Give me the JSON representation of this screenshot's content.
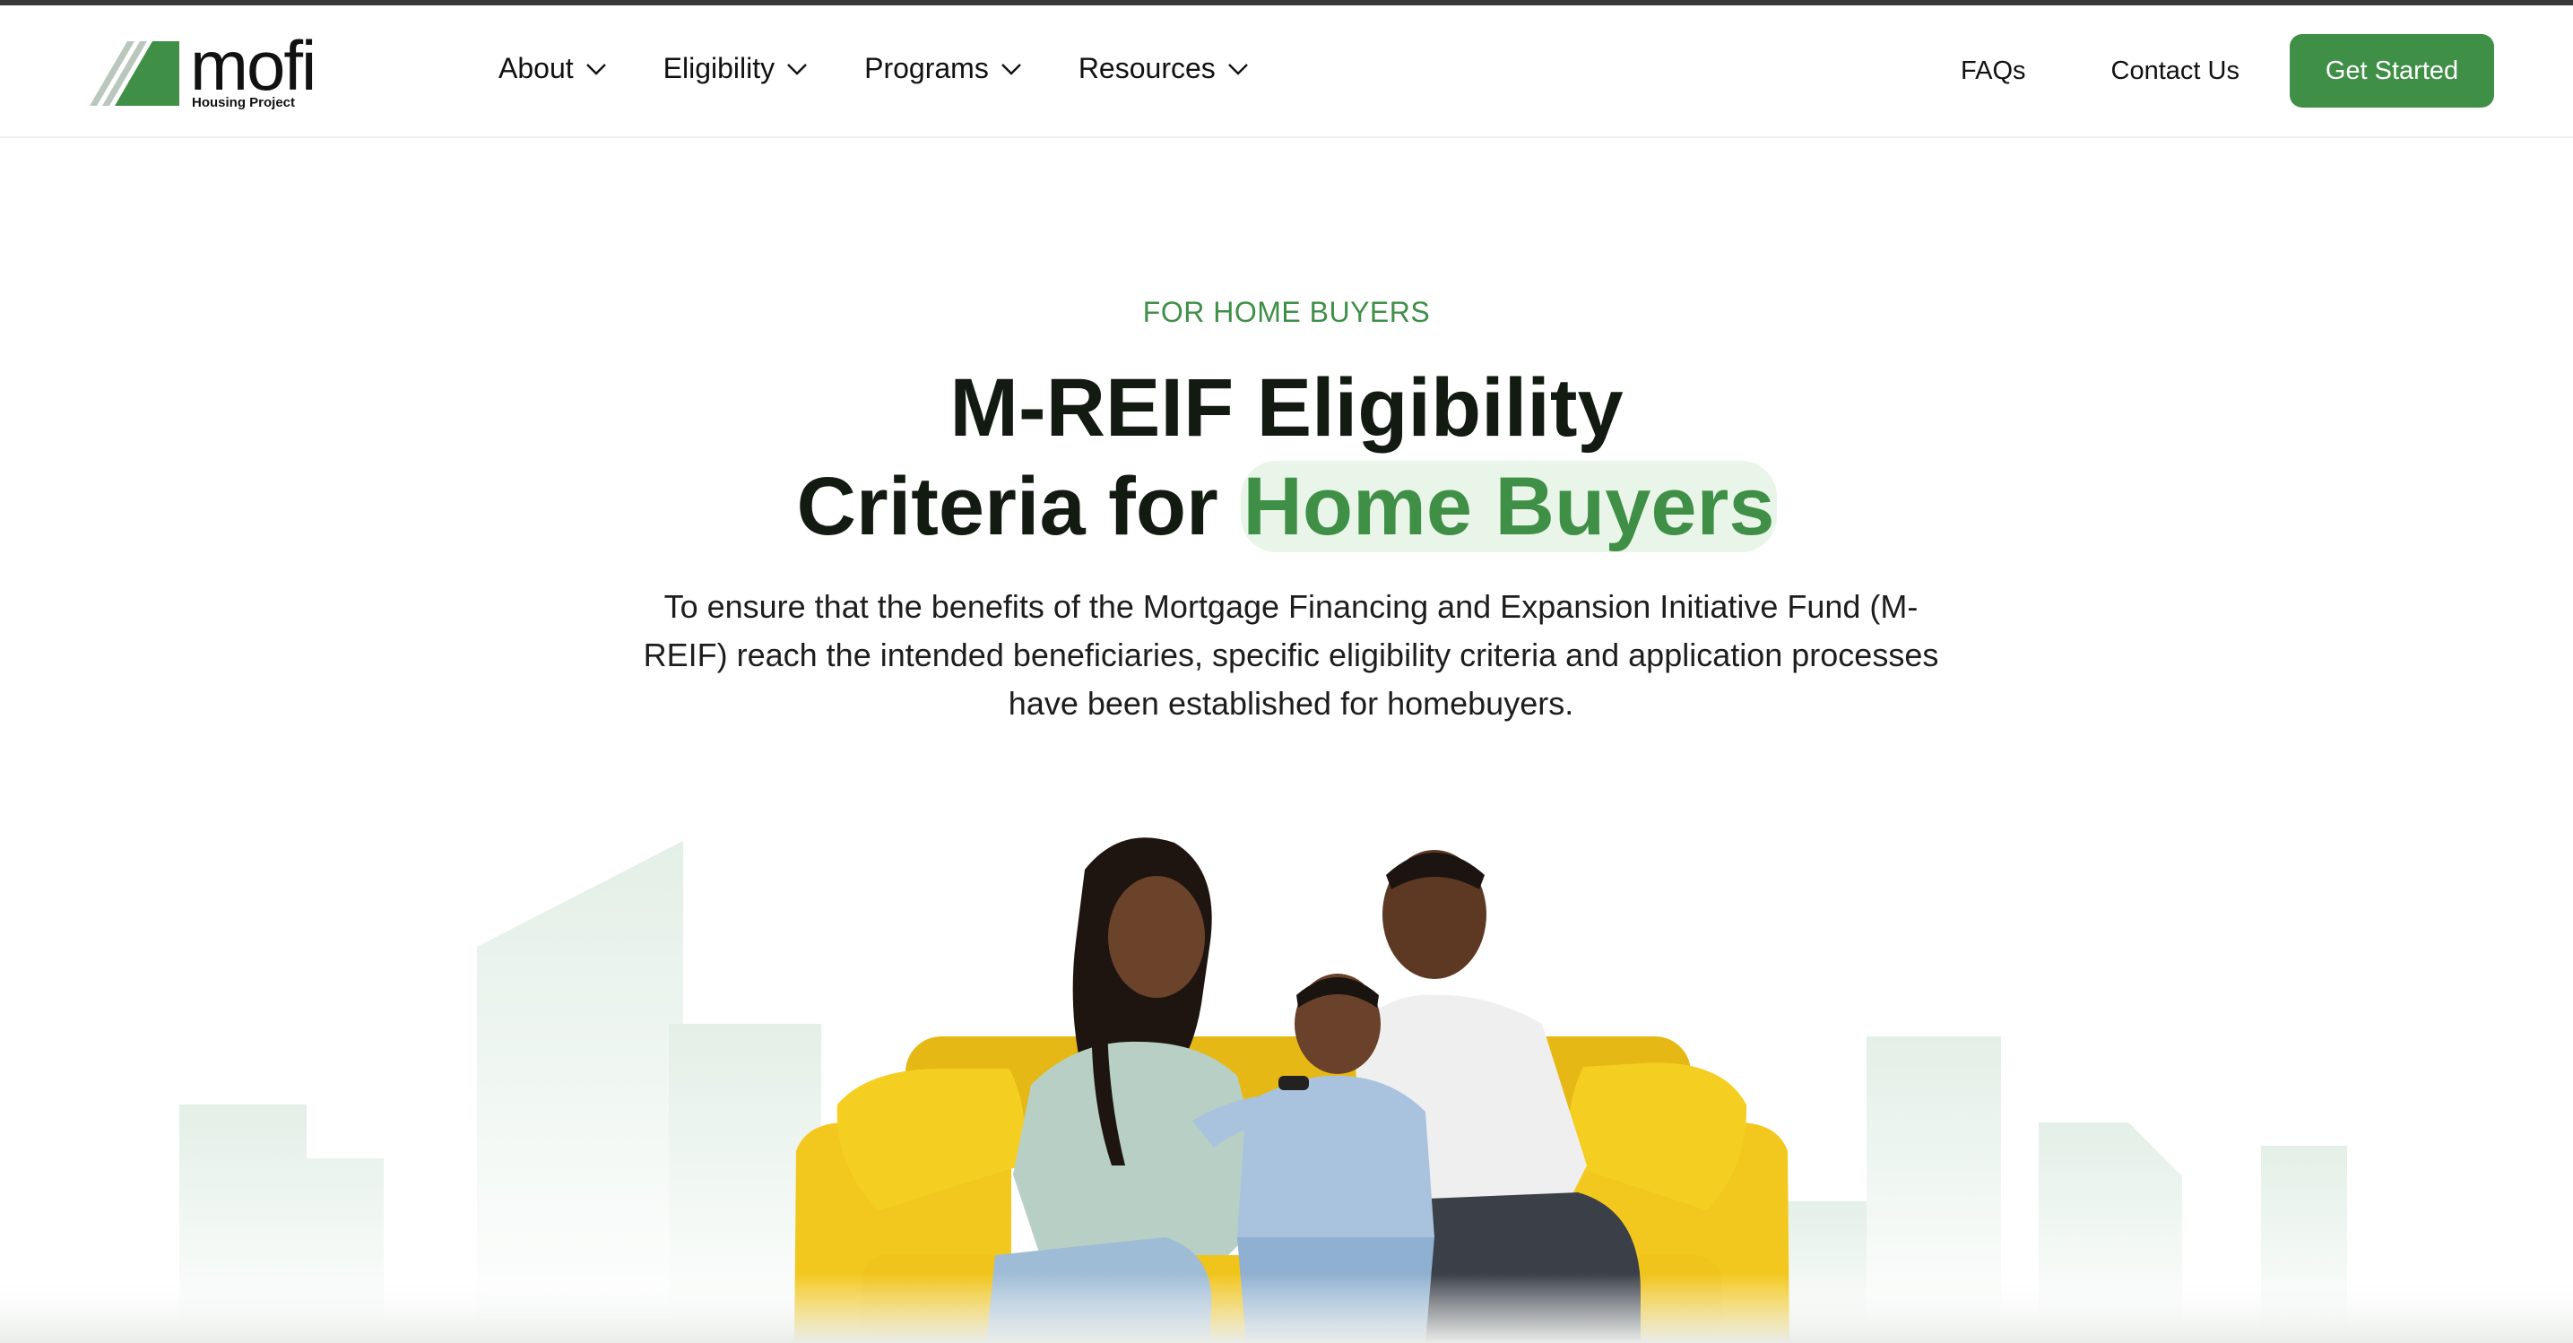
{
  "brand": {
    "name": "mofi",
    "tagline": "Housing Project",
    "accent_color": "#3f8f47"
  },
  "nav": {
    "items": [
      {
        "label": "About",
        "icon": "chevron-down-icon"
      },
      {
        "label": "Eligibility",
        "icon": "chevron-down-icon"
      },
      {
        "label": "Programs",
        "icon": "chevron-down-icon"
      },
      {
        "label": "Resources",
        "icon": "chevron-down-icon"
      }
    ],
    "faqs_label": "FAQs",
    "contact_label": "Contact Us",
    "cta_label": "Get Started"
  },
  "hero": {
    "eyebrow": "FOR HOME BUYERS",
    "title_line1": "M-REIF Eligibility",
    "title_line2_prefix": "Criteria for ",
    "title_highlight": "Home Buyers",
    "description": "To ensure that the benefits of the Mortgage Financing and Expansion Initiative Fund (M-REIF) reach the intended beneficiaries, specific eligibility criteria and application processes have been established for homebuyers."
  },
  "illustration": {
    "subject": "family-on-yellow-sofa",
    "sofa_color": "#f2c81e",
    "building_color": "#e8f2ec"
  }
}
